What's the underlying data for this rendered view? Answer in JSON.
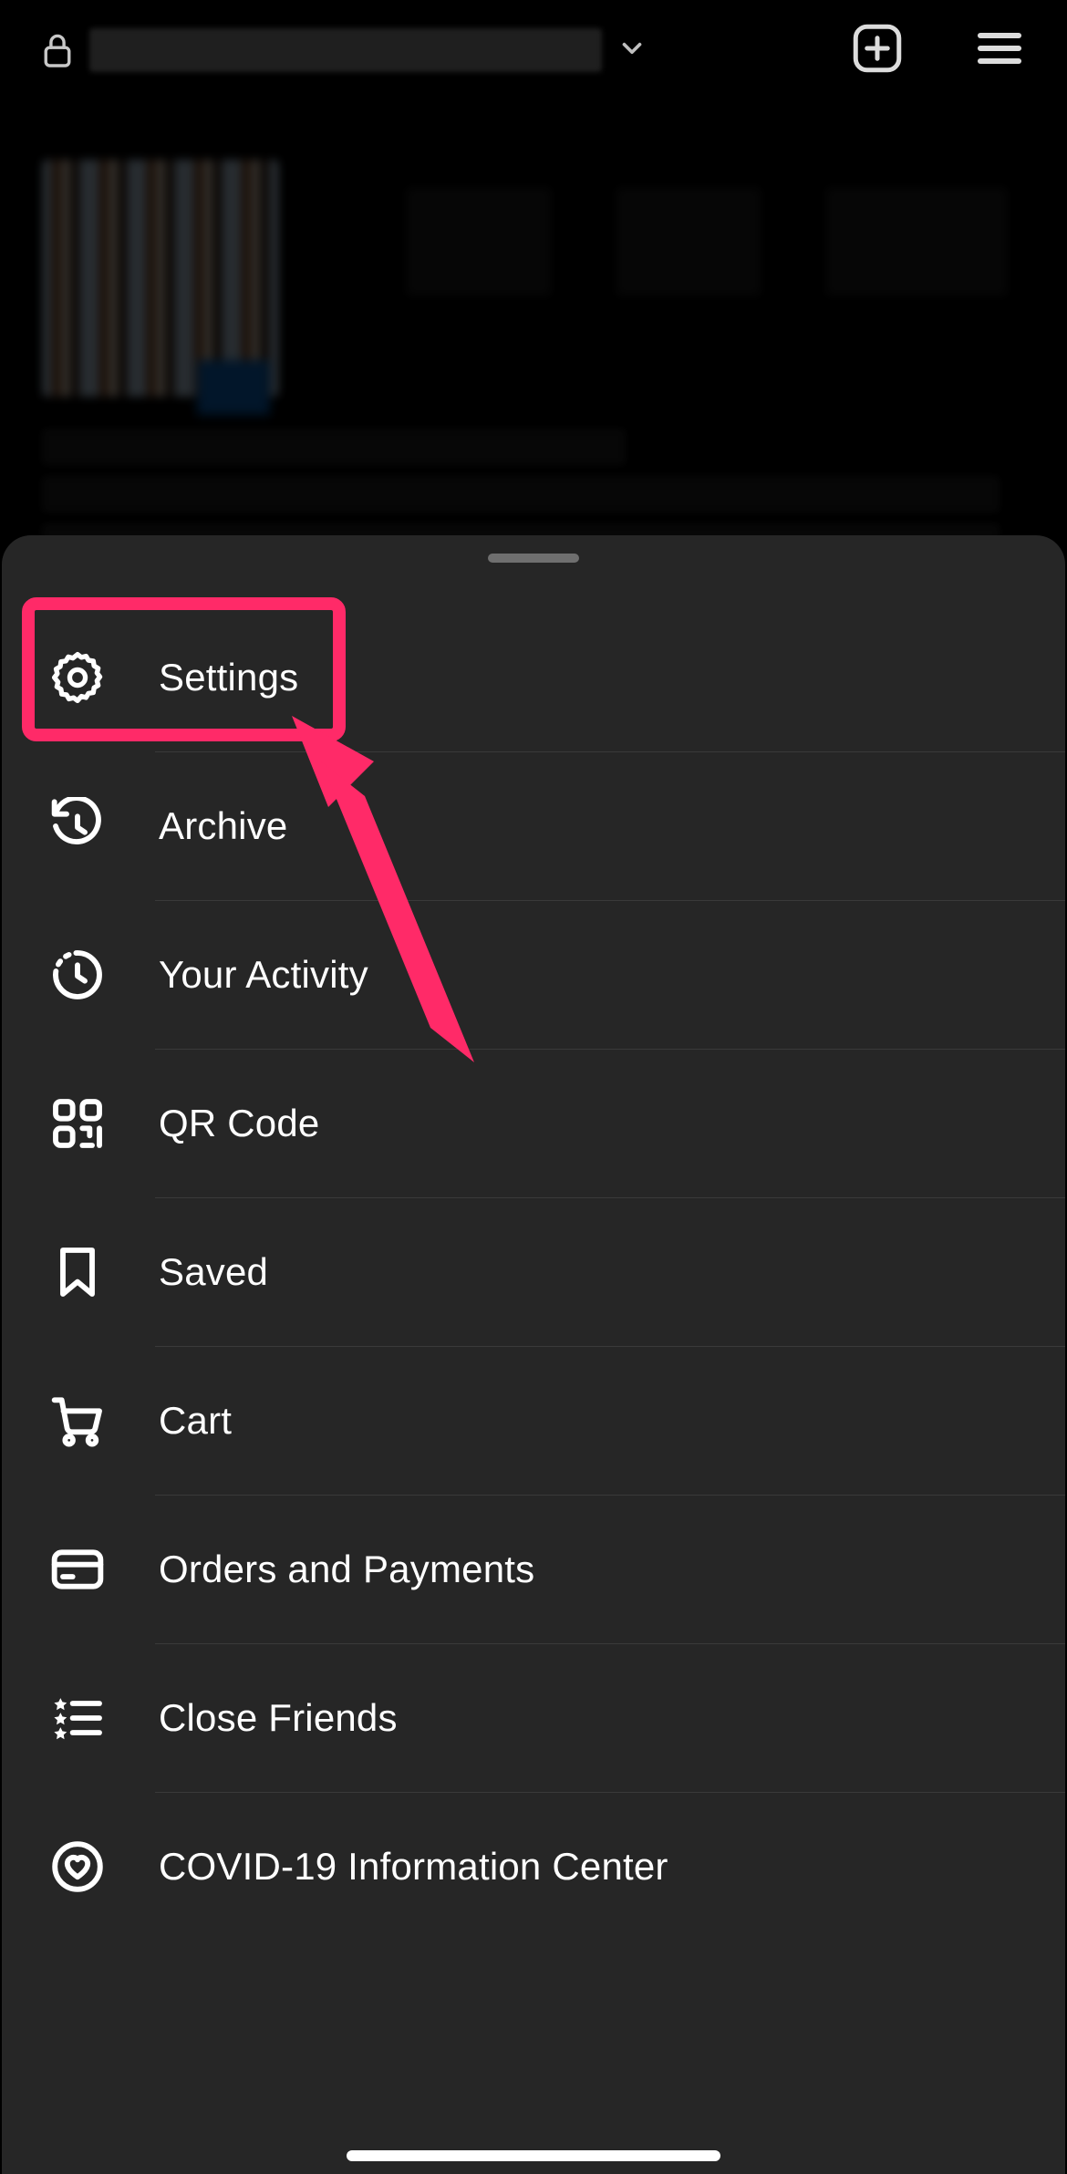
{
  "header": {
    "username_redacted": true,
    "icons": {
      "lock": "lock-icon",
      "chevron": "chevron-down-icon",
      "add": "plus-square-icon",
      "menu": "hamburger-icon"
    }
  },
  "sheet": {
    "items": [
      {
        "id": "settings",
        "label": "Settings",
        "icon": "gear-icon",
        "highlighted": true
      },
      {
        "id": "archive",
        "label": "Archive",
        "icon": "history-icon"
      },
      {
        "id": "your-activity",
        "label": "Your Activity",
        "icon": "activity-clock-icon"
      },
      {
        "id": "qr-code",
        "label": "QR Code",
        "icon": "qr-code-icon"
      },
      {
        "id": "saved",
        "label": "Saved",
        "icon": "bookmark-icon"
      },
      {
        "id": "cart",
        "label": "Cart",
        "icon": "cart-icon"
      },
      {
        "id": "orders",
        "label": "Orders and Payments",
        "icon": "credit-card-icon"
      },
      {
        "id": "close-friends",
        "label": "Close Friends",
        "icon": "star-list-icon"
      },
      {
        "id": "covid",
        "label": "COVID-19 Information Center",
        "icon": "heart-circle-icon"
      }
    ]
  },
  "annotation": {
    "highlight_color": "#ff2a68",
    "arrow_color": "#ff2a68"
  }
}
